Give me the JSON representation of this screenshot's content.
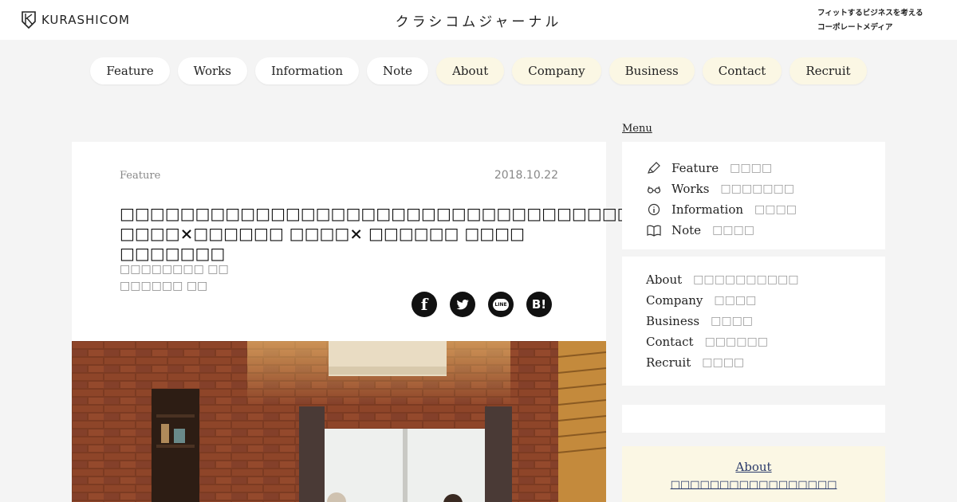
{
  "header": {
    "logo_text": "KURASHICOM",
    "site_title": "クラシコムジャーナル",
    "tagline_line1": "フィットするビジネスを考える",
    "tagline_line2": "コーポレートメディア"
  },
  "nav": {
    "pills": [
      {
        "label": "Feature"
      },
      {
        "label": "Works"
      },
      {
        "label": "Information"
      },
      {
        "label": "Note"
      },
      {
        "label": "About"
      },
      {
        "label": "Company"
      },
      {
        "label": "Business"
      },
      {
        "label": "Contact"
      },
      {
        "label": "Recruit"
      }
    ]
  },
  "article": {
    "category": "Feature",
    "date": "2018.10.22",
    "title": "□□□□□□□□□□□□□□□□□□□□□□□□□□□□□□□□□□ □□□□×□□□□□□ □□□□× □□□□□□ □□□□ □□□□□□□",
    "author_line1": "□□□□□□□□ □□",
    "author_line2": "□□□□□□ □□"
  },
  "share": {
    "facebook": "f",
    "line": "LINE",
    "hatena": "B!"
  },
  "sidebar": {
    "menu_label": "Menu",
    "main_items": [
      {
        "en": "Feature",
        "jp": "□□□□",
        "icon": "pen-icon"
      },
      {
        "en": "Works",
        "jp": "□□□□□□□",
        "icon": "glasses-icon"
      },
      {
        "en": "Information",
        "jp": "□□□□",
        "icon": "info-icon"
      },
      {
        "en": "Note",
        "jp": "□□□□",
        "icon": "book-icon"
      }
    ],
    "corporate_items": [
      {
        "en": "About",
        "jp": "□□□□□□□□□□"
      },
      {
        "en": "Company",
        "jp": "□□□□"
      },
      {
        "en": "Business",
        "jp": "□□□□"
      },
      {
        "en": "Contact",
        "jp": "□□□□□□"
      },
      {
        "en": "Recruit",
        "jp": "□□□□"
      }
    ],
    "about": {
      "title": "About",
      "subtitle": "□□□□□□□□□□□□□□□□□"
    }
  },
  "colors": {
    "background": "#f4f4f4",
    "pill_cream": "#fbf7e4",
    "about_link": "#2a3a6a"
  }
}
